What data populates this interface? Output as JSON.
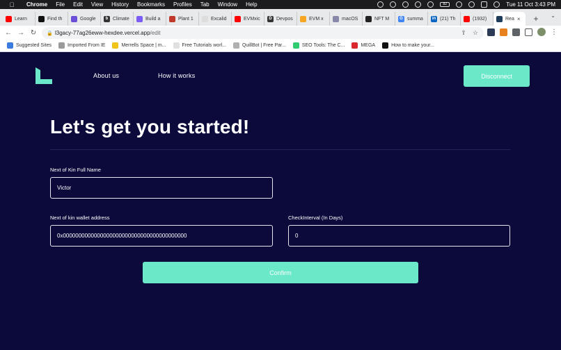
{
  "menubar": {
    "app": "Chrome",
    "items": [
      "File",
      "Edit",
      "View",
      "History",
      "Bookmarks",
      "Profiles",
      "Tab",
      "Window",
      "Help"
    ],
    "datetime": "Tue 11 Oct 3:43 PM",
    "battery": "82"
  },
  "tabs": [
    {
      "title": "Learn",
      "color": "#ff0000",
      "glyph": ""
    },
    {
      "title": "Find th",
      "color": "#111111",
      "glyph": ""
    },
    {
      "title": "Google",
      "color": "#6b4fd8",
      "glyph": ""
    },
    {
      "title": "Climate",
      "color": "#333333",
      "glyph": "b"
    },
    {
      "title": "Build a",
      "color": "#7b5cf5",
      "glyph": ""
    },
    {
      "title": "Plant 1",
      "color": "#c0392b",
      "glyph": ""
    },
    {
      "title": "Excalid",
      "color": "#dddddd",
      "glyph": ""
    },
    {
      "title": "EVMxic",
      "color": "#ff0000",
      "glyph": ""
    },
    {
      "title": "Devpos",
      "color": "#333333",
      "glyph": "D"
    },
    {
      "title": "EVM x",
      "color": "#f5a623",
      "glyph": ""
    },
    {
      "title": "macOS",
      "color": "#8888aa",
      "glyph": ""
    },
    {
      "title": "NFT M",
      "color": "#222222",
      "glyph": ""
    },
    {
      "title": "summa",
      "color": "#4285f4",
      "glyph": "G"
    },
    {
      "title": "(21) Th",
      "color": "#0a66c2",
      "glyph": "in"
    },
    {
      "title": "(1932)",
      "color": "#ff0000",
      "glyph": ""
    },
    {
      "title": "Rea",
      "color": "#1f3b5c",
      "glyph": ""
    }
  ],
  "address_bar": {
    "host": "l3gacy-77ag26eww-hexdee.vercel.app",
    "path": "/edit"
  },
  "bookmarks": [
    {
      "label": "Suggested Sites",
      "color": "#3b7be0"
    },
    {
      "label": "Imported From IE",
      "color": "#9a9a9a"
    },
    {
      "label": "Merrells Space | m...",
      "color": "#f0c419"
    },
    {
      "label": "Free Tutorials worl...",
      "color": "#e0e0e0"
    },
    {
      "label": "QuillBot | Free Par...",
      "color": "#b0b0b0"
    },
    {
      "label": "SEO Tools: The C...",
      "color": "#2ecc71"
    },
    {
      "label": "MEGA",
      "color": "#d9272e"
    },
    {
      "label": "How to make your...",
      "color": "#111111"
    }
  ],
  "nav": {
    "about": "About us",
    "how": "How it works",
    "disconnect": "Disconnect"
  },
  "form": {
    "title": "Let's get you started!",
    "kin_name_label": "Next of Kin Full Name",
    "kin_name_value": "Victor",
    "wallet_label": "Next of kin wallet address",
    "wallet_value": "0x0000000000000000000000000000000000000000",
    "interval_label": "CheckInterval (In Days)",
    "interval_value": "0",
    "confirm": "Confirm"
  },
  "colors": {
    "page_bg": "#0b0a3b",
    "accent": "#6ae8c8"
  }
}
